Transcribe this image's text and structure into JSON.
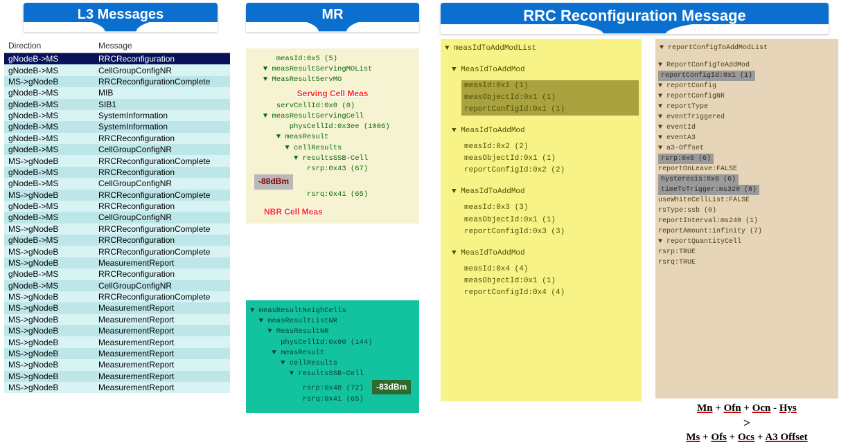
{
  "banners": {
    "l3": "L3 Messages",
    "mr": "MR",
    "rrc": "RRC Reconfiguration Message"
  },
  "l3table": {
    "headers": {
      "direction": "Direction",
      "message": "Message"
    },
    "rows": [
      {
        "dir": "gNodeB->MS",
        "msg": "RRCReconfiguration",
        "sel": true
      },
      {
        "dir": "gNodeB->MS",
        "msg": "CellGroupConfigNR"
      },
      {
        "dir": "MS->gNodeB",
        "msg": "RRCReconfigurationComplete"
      },
      {
        "dir": "gNodeB->MS",
        "msg": "MIB"
      },
      {
        "dir": "gNodeB->MS",
        "msg": "SIB1"
      },
      {
        "dir": "gNodeB->MS",
        "msg": "SystemInformation"
      },
      {
        "dir": "gNodeB->MS",
        "msg": "SystemInformation"
      },
      {
        "dir": "gNodeB->MS",
        "msg": "RRCReconfiguration"
      },
      {
        "dir": "gNodeB->MS",
        "msg": "CellGroupConfigNR"
      },
      {
        "dir": "MS->gNodeB",
        "msg": "RRCReconfigurationComplete"
      },
      {
        "dir": "gNodeB->MS",
        "msg": "RRCReconfiguration"
      },
      {
        "dir": "gNodeB->MS",
        "msg": "CellGroupConfigNR"
      },
      {
        "dir": "MS->gNodeB",
        "msg": "RRCReconfigurationComplete"
      },
      {
        "dir": "gNodeB->MS",
        "msg": "RRCReconfiguration"
      },
      {
        "dir": "gNodeB->MS",
        "msg": "CellGroupConfigNR"
      },
      {
        "dir": "MS->gNodeB",
        "msg": "RRCReconfigurationComplete"
      },
      {
        "dir": "gNodeB->MS",
        "msg": "RRCReconfiguration"
      },
      {
        "dir": "MS->gNodeB",
        "msg": "RRCReconfigurationComplete"
      },
      {
        "dir": "MS->gNodeB",
        "msg": "MeasurementReport"
      },
      {
        "dir": "gNodeB->MS",
        "msg": "RRCReconfiguration"
      },
      {
        "dir": "gNodeB->MS",
        "msg": "CellGroupConfigNR"
      },
      {
        "dir": "MS->gNodeB",
        "msg": "RRCReconfigurationComplete"
      },
      {
        "dir": "MS->gNodeB",
        "msg": "MeasurementReport"
      },
      {
        "dir": "MS->gNodeB",
        "msg": "MeasurementReport"
      },
      {
        "dir": "MS->gNodeB",
        "msg": "MeasurementReport"
      },
      {
        "dir": "MS->gNodeB",
        "msg": "MeasurementReport"
      },
      {
        "dir": "MS->gNodeB",
        "msg": "MeasurementReport"
      },
      {
        "dir": "MS->gNodeB",
        "msg": "MeasurementReport"
      },
      {
        "dir": "MS->gNodeB",
        "msg": "MeasurementReport"
      },
      {
        "dir": "MS->gNodeB",
        "msg": "MeasurementReport"
      }
    ]
  },
  "mr_top": {
    "lines": [
      "      measId:0x5 (5)",
      "   ▼ measResultServingMOList",
      "",
      "   ▼ MeasResultServMO"
    ],
    "serving_label": "Serving Cell Meas",
    "lines2": [
      "      servCellId:0x0 (0)",
      "   ▼ measResultServingCell",
      "",
      "         physCellId:0x3ee (1006)",
      "      ▼ measResult",
      "",
      "        ▼ cellResults",
      "",
      "          ▼ resultsSSB-Cell"
    ],
    "rsrp": "             rsrp:0x43 (67)",
    "rsrp_badge": "-88dBm",
    "rsrq": "             rsrq:0x41 (65)",
    "nbr_label": "NBR Cell Meas"
  },
  "mr_bot": {
    "lines": [
      "▼ measResultNeighCells",
      "",
      "  ▼ measResultListNR",
      "",
      "    ▼ MeasResultNR",
      "",
      "",
      "       physCellId:0x90 (144)",
      "     ▼ measResult",
      "",
      "       ▼ cellResults",
      "",
      "         ▼ resultsSSB-Cell"
    ],
    "rsrp": "            rsrp:0x48 (72)",
    "rsrp_badge": "-83dBm",
    "rsrq": "            rsrq:0x41 (65)"
  },
  "rrc1": {
    "title": "▼ measIdToAddModList",
    "blocks": [
      {
        "head": "▼ MeasIdToAddMod",
        "rows": [
          "measId:0x1 (1)",
          "measObjectId:0x1 (1)",
          "reportConfigId:0x1 (1)"
        ],
        "hl": true
      },
      {
        "head": "▼ MeasIdToAddMod",
        "rows": [
          "measId:0x2 (2)",
          "",
          "measObjectId:0x1 (1)",
          "reportConfigId:0x2 (2)"
        ]
      },
      {
        "head": "▼ MeasIdToAddMod",
        "rows": [
          "measId:0x3 (3)",
          "",
          "measObjectId:0x1 (1)",
          "",
          "reportConfigId:0x3 (3)"
        ]
      },
      {
        "head": "▼ MeasIdToAddMod",
        "rows": [
          "measId:0x4 (4)",
          "measObjectId:0x1 (1)",
          "",
          "reportConfigId:0x4 (4)"
        ]
      }
    ]
  },
  "rrc2": {
    "title": "▼ reportConfigToAddModList",
    "lines": [
      "  ▼ ReportConfigToAddMod",
      "     #reportConfigId:0x1 (1)",
      "   ▼ reportConfig",
      "",
      "    ▼ reportConfigNR",
      "     ▼ reportType",
      "",
      "      ▼ eventTriggered",
      "",
      "        ▼ eventId",
      "",
      "         ▼ eventA3",
      "          ▼ a3-Offset",
      "",
      "             #rsrp:0x6 (6)",
      "            reportOnLeave:FALSE",
      "",
      "            #hysteresis:0x6 (6)",
      "            #timeToTrigger:ms320 (8)",
      "            useWhiteCellList:FALSE",
      "          rsType:ssb (0)",
      "",
      "          reportInterval:ms240 (1)",
      "          reportAmount:infinity (7)",
      "        ▼ reportQuantityCell",
      "            rsrp:TRUE",
      "            rsrq:TRUE"
    ]
  },
  "formula": {
    "line1_parts": [
      "Mn",
      " + ",
      "Ofn",
      " + ",
      "Ocn",
      " - ",
      "Hys"
    ],
    "gt": ">",
    "line3_parts": [
      "Ms",
      " + ",
      "Ofs",
      " + ",
      "Ocs",
      " + ",
      "A3 Offset"
    ]
  }
}
